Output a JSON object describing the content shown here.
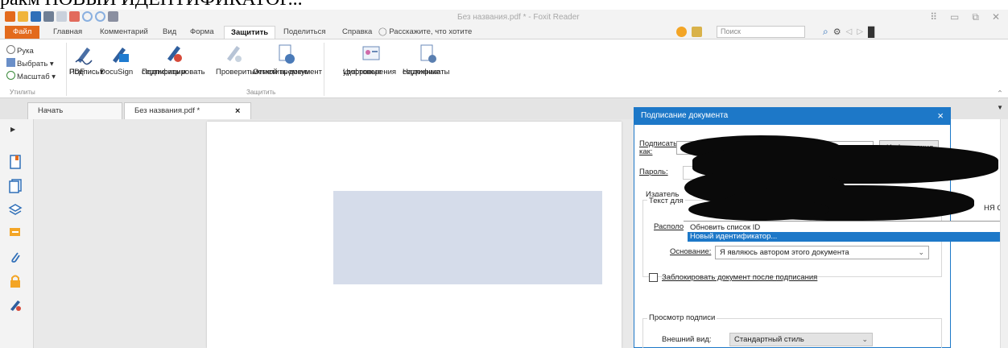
{
  "caption": "ракм НОВЫЙ ИДЕНТИФИКАТОР...",
  "window": {
    "title": "Без названия.pdf * - Foxit Reader"
  },
  "menu": {
    "file": "Файл",
    "items": [
      "Главная",
      "Комментарий",
      "Вид",
      "Форма",
      "Защитить",
      "Поделиться",
      "Справка"
    ],
    "active": "Защитить",
    "tellme": "Расскажите, что хотите",
    "search_placeholder": "Поиск"
  },
  "ribbon": {
    "utilities": [
      "Рука",
      "Выбрать",
      "Масштаб"
    ],
    "utilities_label": "Утилиты",
    "buttons": {
      "sign_pdf": [
        "Подпись",
        "PDF"
      ],
      "docusign": "DocuSign",
      "sign_certify": [
        "Подписать и",
        "сертифицировать"
      ],
      "verify": "Проверить",
      "timestamp": [
        "Отметить документ",
        "меткой времени"
      ],
      "digital_ids": [
        "Цифровые",
        "удостоверения"
      ],
      "trusted_certs": [
        "Надежные",
        "сертификаты"
      ]
    },
    "protect_label": "Защитить"
  },
  "tabs": {
    "start": "Начать",
    "doc": "Без названия.pdf *",
    "close": "×"
  },
  "dialog": {
    "title": "Подписание документа",
    "close": "×",
    "sign_as_label": [
      "Подписать",
      "как:"
    ],
    "info_button": "Информация",
    "password_label": "Пароль:",
    "issuer_label": "Издатель",
    "issuer_tail": "НЯ О",
    "text_for_label": "Текст для",
    "location_label": "Располож",
    "reason_label": "Основание:",
    "reason_value": "Я являюсь автором этого документа",
    "lock_label": "Заблокировать документ после подписания",
    "preview_group": "Просмотр подписи",
    "appearance_label": "Внешний вид:",
    "appearance_value": "Стандартный стиль"
  },
  "dropdown": {
    "items": [
      "Обновить список ID",
      "Новый идентификатор..."
    ],
    "selected": "Новый идентификатор..."
  },
  "colors": {
    "accent": "#1d78c8",
    "file_tab": "#e36a1c",
    "signature_box": "#d5dcea"
  }
}
